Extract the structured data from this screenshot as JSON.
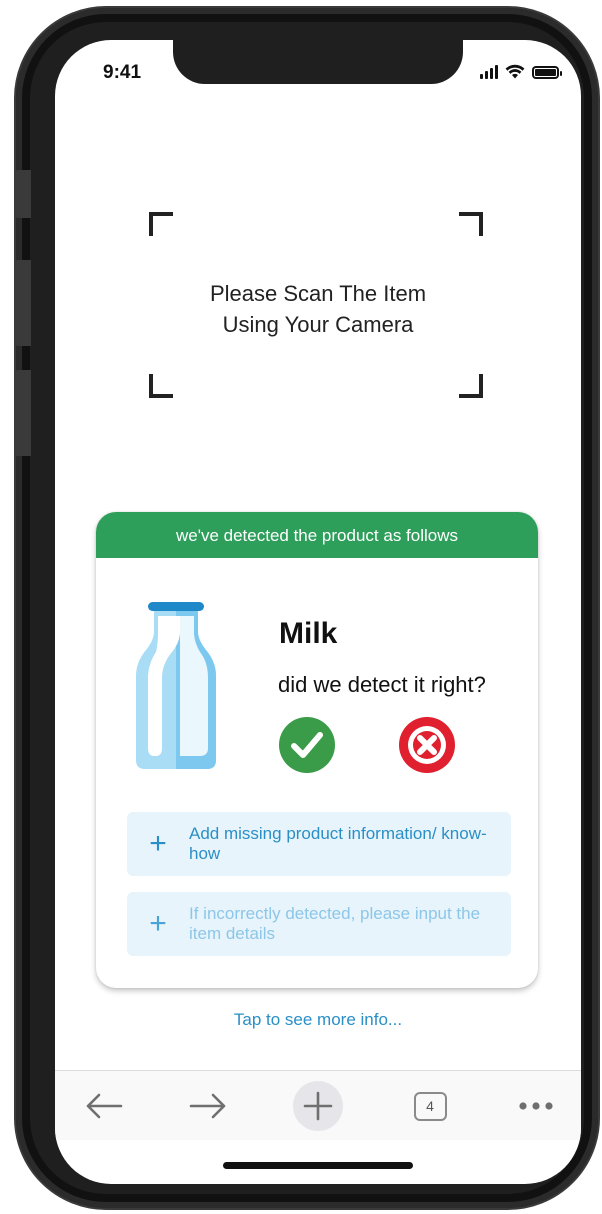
{
  "status_bar": {
    "time": "9:41"
  },
  "scanner": {
    "instruction_line1": "Please Scan The Item",
    "instruction_line2": "Using Your Camera"
  },
  "detection_card": {
    "header": "we've detected the product as follows",
    "product_name": "Milk",
    "question": "did we detect it right?",
    "confirm_icon": "check-icon",
    "reject_icon": "x-icon",
    "actions": [
      {
        "icon": "plus-icon",
        "label": "Add missing product information/ know-how"
      },
      {
        "icon": "plus-icon",
        "label": "If incorrectly detected, please input the item details"
      }
    ]
  },
  "more_info_link": "Tap to see more info...",
  "browser_toolbar": {
    "tab_count": "4",
    "buttons": [
      "back-arrow-icon",
      "forward-arrow-icon",
      "plus-icon",
      "tabs-icon",
      "more-dots-icon"
    ]
  },
  "colors": {
    "header_green": "#2e9e5b",
    "confirm_green": "#3a9b48",
    "reject_red": "#e0202e",
    "link_blue": "#2a8fc7",
    "action_bg": "#e8f4fb"
  }
}
